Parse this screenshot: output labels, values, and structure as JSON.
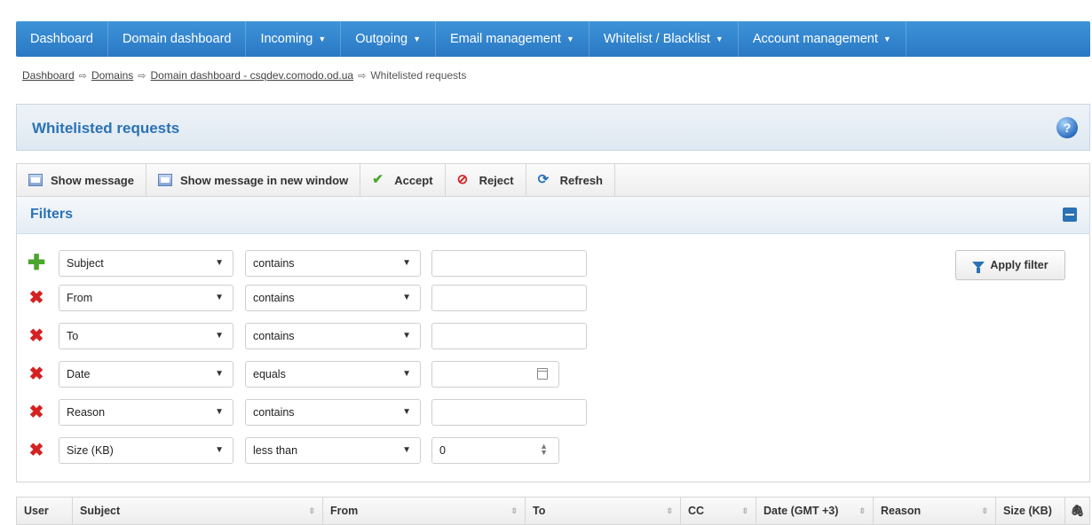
{
  "nav": {
    "items": [
      {
        "label": "Dashboard",
        "caret": false
      },
      {
        "label": "Domain dashboard",
        "caret": false
      },
      {
        "label": "Incoming",
        "caret": true
      },
      {
        "label": "Outgoing",
        "caret": true
      },
      {
        "label": "Email management",
        "caret": true
      },
      {
        "label": "Whitelist / Blacklist",
        "caret": true
      },
      {
        "label": "Account management",
        "caret": true
      }
    ]
  },
  "breadcrumb": {
    "items": [
      "Dashboard",
      "Domains",
      "Domain dashboard - csqdev.comodo.od.ua"
    ],
    "current": "Whitelisted requests"
  },
  "page": {
    "title": "Whitelisted requests"
  },
  "toolbar": {
    "show_message": "Show message",
    "show_message_new_window": "Show message in new window",
    "accept": "Accept",
    "reject": "Reject",
    "refresh": "Refresh"
  },
  "filters": {
    "title": "Filters",
    "apply_label": "Apply filter",
    "rows": [
      {
        "field": "Subject",
        "operator": "contains",
        "value": ""
      },
      {
        "field": "From",
        "operator": "contains",
        "value": ""
      },
      {
        "field": "To",
        "operator": "contains",
        "value": ""
      },
      {
        "field": "Date",
        "operator": "equals",
        "value": ""
      },
      {
        "field": "Reason",
        "operator": "contains",
        "value": ""
      },
      {
        "field": "Size (KB)",
        "operator": "less than",
        "value": "0"
      }
    ]
  },
  "table": {
    "columns": [
      "User",
      "Subject",
      "From",
      "To",
      "CC",
      "Date (GMT +3)",
      "Reason",
      "Size (KB)"
    ]
  },
  "colors": {
    "nav_bg": "#2a78c4",
    "title_text": "#2a72b5",
    "add_icon": "#4aa62c",
    "remove_icon": "#d52121"
  }
}
